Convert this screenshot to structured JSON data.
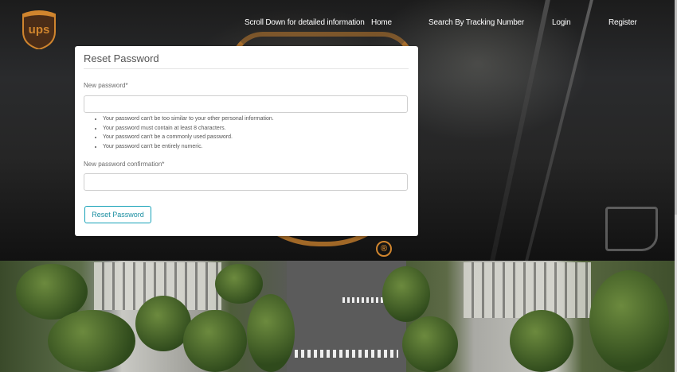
{
  "brand": {
    "logo_text": "ups",
    "logo_color": "#d0852e",
    "logo_bg": "#4a2c17",
    "registered_mark": "®"
  },
  "nav": {
    "links": [
      {
        "label": "Scroll Down for detailed information"
      },
      {
        "label": "Home"
      },
      {
        "label": "Search By Tracking Number"
      },
      {
        "label": "Login"
      },
      {
        "label": "Register"
      }
    ]
  },
  "form": {
    "title": "Reset Password",
    "new_password": {
      "label": "New password*",
      "value": "",
      "placeholder": ""
    },
    "help_text": [
      "Your password can't be too similar to your other personal information.",
      "Your password must contain at least 8 characters.",
      "Your password can't be a commonly used password.",
      "Your password can't be entirely numeric."
    ],
    "confirm_password": {
      "label": "New password confirmation*",
      "value": "",
      "placeholder": ""
    },
    "submit_label": "Reset Password"
  },
  "colors": {
    "accent": "#17a2b8",
    "brand_gold": "#d0852e"
  }
}
